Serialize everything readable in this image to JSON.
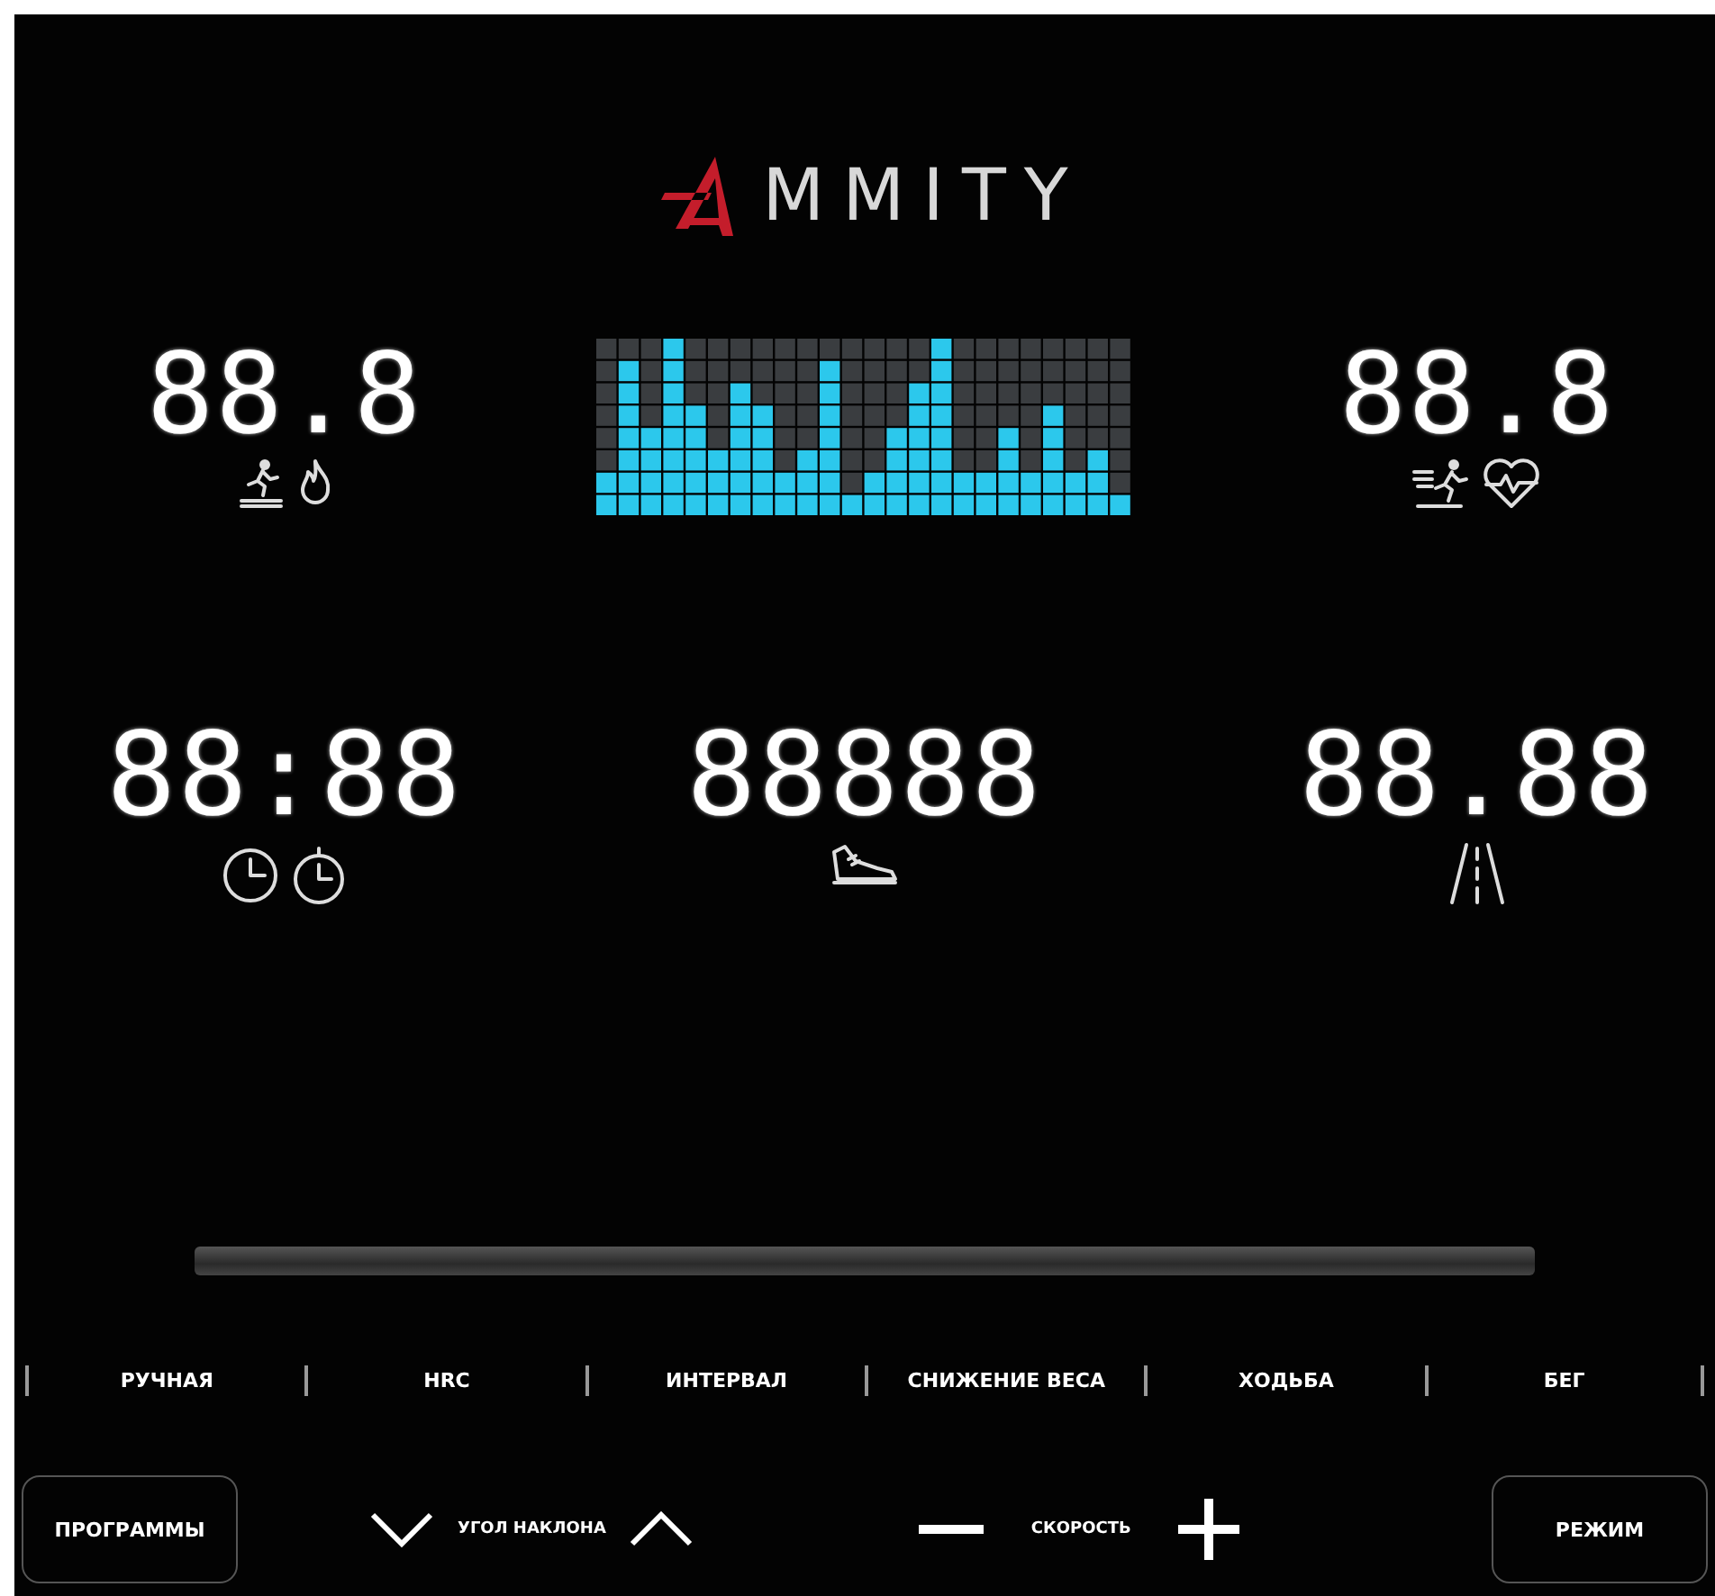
{
  "logo": {
    "text": "MMITY"
  },
  "top_readouts": [
    {
      "kind": "calories",
      "value": "88.8"
    },
    {
      "kind": "pulse",
      "value": "88.8"
    }
  ],
  "bottom_readouts": [
    {
      "kind": "time",
      "value": "88:88"
    },
    {
      "kind": "steps",
      "value": "88888"
    },
    {
      "kind": "distance",
      "value": "88.88"
    }
  ],
  "programs": [
    "РУЧНАЯ",
    "HRC",
    "ИНТЕРВАЛ",
    "СНИЖЕНИЕ ВЕСА",
    "ХОДЬБА",
    "БЕГ"
  ],
  "controls": {
    "programs_button": "ПРОГРАММЫ",
    "incline_label": "УГОЛ НАКЛОНА",
    "speed_label": "СКОРОСТЬ",
    "mode_button": "РЕЖИМ"
  }
}
